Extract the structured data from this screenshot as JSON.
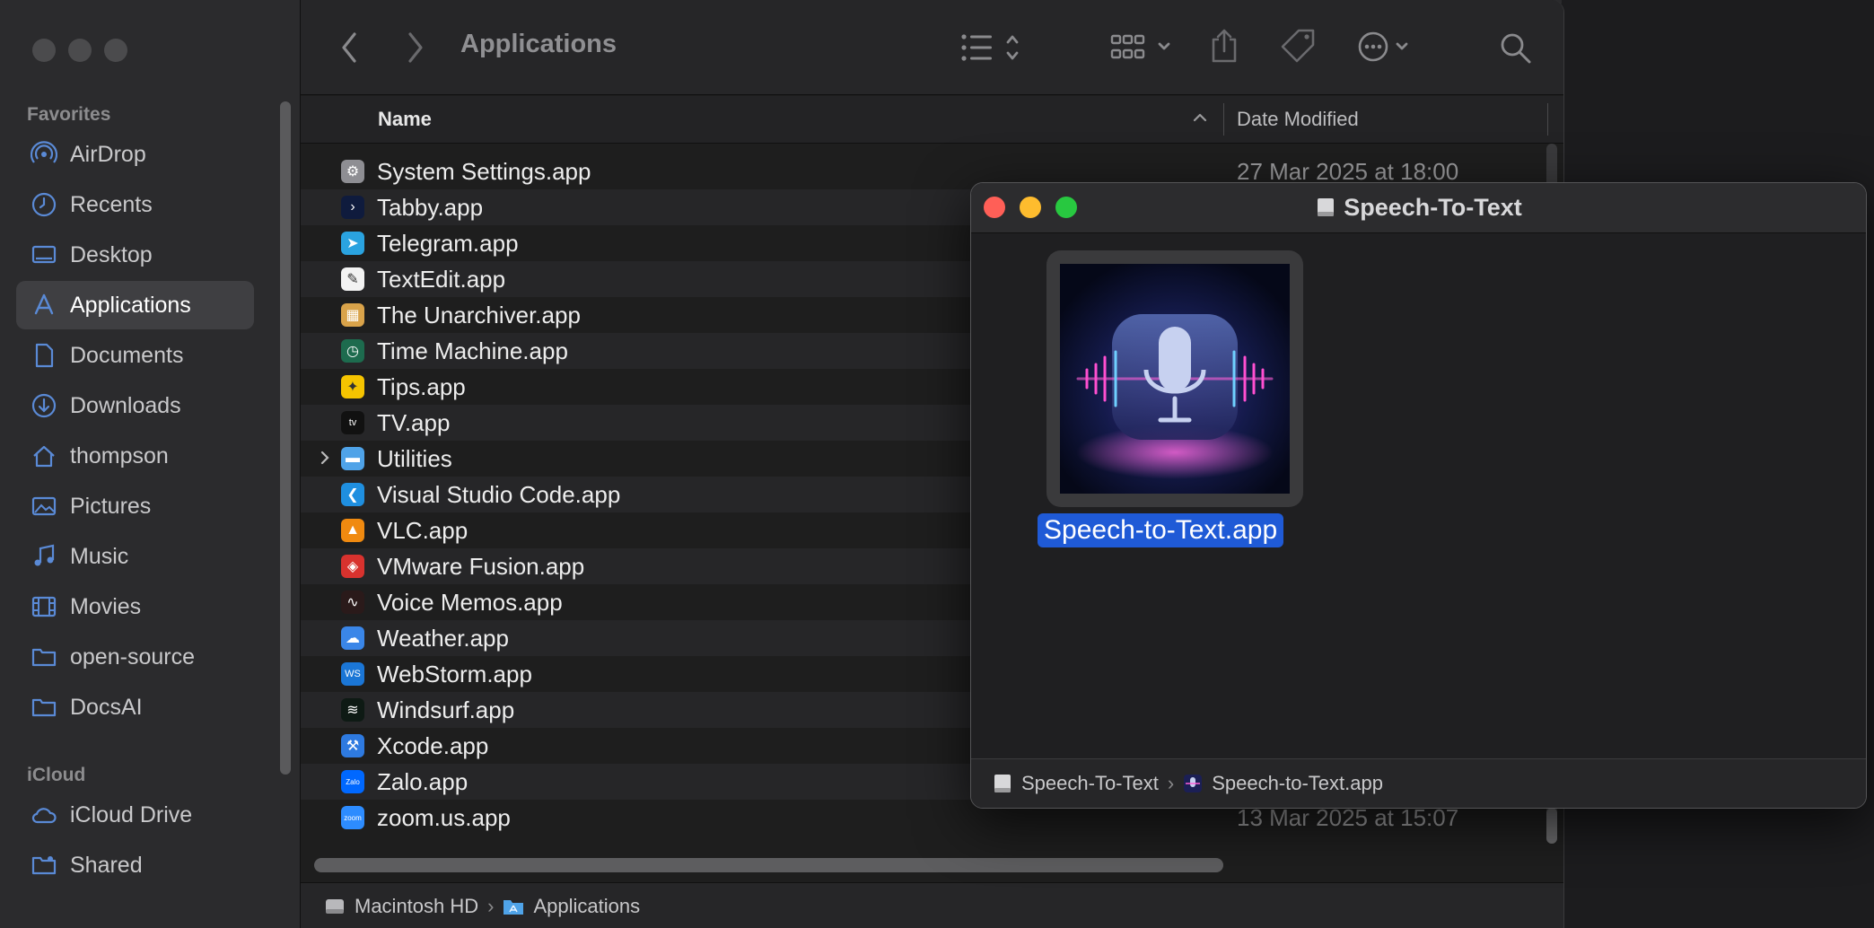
{
  "finder": {
    "title": "Applications",
    "sidebar": {
      "favorites_header": "Favorites",
      "icloud_header": "iCloud",
      "favorites": [
        {
          "label": "AirDrop",
          "icon": "airdrop-icon"
        },
        {
          "label": "Recents",
          "icon": "clock-icon"
        },
        {
          "label": "Desktop",
          "icon": "desktop-icon"
        },
        {
          "label": "Applications",
          "icon": "applications-icon",
          "active": true
        },
        {
          "label": "Documents",
          "icon": "document-icon"
        },
        {
          "label": "Downloads",
          "icon": "download-icon"
        },
        {
          "label": "thompson",
          "icon": "home-icon"
        },
        {
          "label": "Pictures",
          "icon": "photo-icon"
        },
        {
          "label": "Music",
          "icon": "music-icon"
        },
        {
          "label": "Movies",
          "icon": "film-icon"
        },
        {
          "label": "open-source",
          "icon": "folder-icon"
        },
        {
          "label": "DocsAI",
          "icon": "folder-icon"
        }
      ],
      "icloud": [
        {
          "label": "iCloud Drive",
          "icon": "cloud-icon"
        },
        {
          "label": "Shared",
          "icon": "shared-folder-icon"
        }
      ]
    },
    "columns": {
      "name": "Name",
      "date": "Date Modified"
    },
    "files": [
      {
        "name": "System Settings.app",
        "date": "27 Mar 2025 at 18:00",
        "icon_color": "#8e8e93",
        "glyph": "⚙"
      },
      {
        "name": "Tabby.app",
        "date": "",
        "icon_color": "#0f1b3d",
        "glyph": "›"
      },
      {
        "name": "Telegram.app",
        "date": "",
        "icon_color": "#2aa3e0",
        "glyph": "➤"
      },
      {
        "name": "TextEdit.app",
        "date": "",
        "icon_color": "#f2f2f2",
        "glyph": "✎"
      },
      {
        "name": "The Unarchiver.app",
        "date": "",
        "icon_color": "#d9a34a",
        "glyph": "▦"
      },
      {
        "name": "Time Machine.app",
        "date": "",
        "icon_color": "#1d6b4e",
        "glyph": "◷"
      },
      {
        "name": "Tips.app",
        "date": "",
        "icon_color": "#f5c400",
        "glyph": "✦"
      },
      {
        "name": "TV.app",
        "date": "",
        "icon_color": "#111111",
        "glyph": "tv"
      },
      {
        "name": "Utilities",
        "date": "",
        "icon_color": "#4fa3e8",
        "glyph": "▬",
        "folder": true
      },
      {
        "name": "Visual Studio Code.app",
        "date": "",
        "icon_color": "#1f8fe0",
        "glyph": "❮"
      },
      {
        "name": "VLC.app",
        "date": "",
        "icon_color": "#f08a10",
        "glyph": "▲"
      },
      {
        "name": "VMware Fusion.app",
        "date": "",
        "icon_color": "#d8322e",
        "glyph": "◈"
      },
      {
        "name": "Voice Memos.app",
        "date": "",
        "icon_color": "#2a1a1a",
        "glyph": "∿"
      },
      {
        "name": "Weather.app",
        "date": "",
        "icon_color": "#3a86e8",
        "glyph": "☁"
      },
      {
        "name": "WebStorm.app",
        "date": "",
        "icon_color": "#1b76d6",
        "glyph": "WS"
      },
      {
        "name": "Windsurf.app",
        "date": "",
        "icon_color": "#0e1a14",
        "glyph": "≋"
      },
      {
        "name": "Xcode.app",
        "date": "",
        "icon_color": "#2e7ae0",
        "glyph": "⚒"
      },
      {
        "name": "Zalo.app",
        "date": "",
        "icon_color": "#0068ff",
        "glyph": "Zalo"
      },
      {
        "name": "zoom.us.app",
        "date": "13 Mar 2025 at 15:07",
        "icon_color": "#2d8cff",
        "glyph": "zoom"
      }
    ],
    "pathbar": {
      "disk": "Macintosh HD",
      "folder": "Applications"
    }
  },
  "popup": {
    "title": "Speech-To-Text",
    "app_label": "Speech-to-Text.app",
    "pathbar": {
      "disk": "Speech-To-Text",
      "app": "Speech-to-Text.app"
    },
    "lights": {
      "close": "#ff5f57",
      "minimize": "#febc2e",
      "zoom": "#28c840"
    }
  },
  "colors": {
    "accent": "#1f5ad6",
    "sidebar_active": "#3f3f42"
  }
}
